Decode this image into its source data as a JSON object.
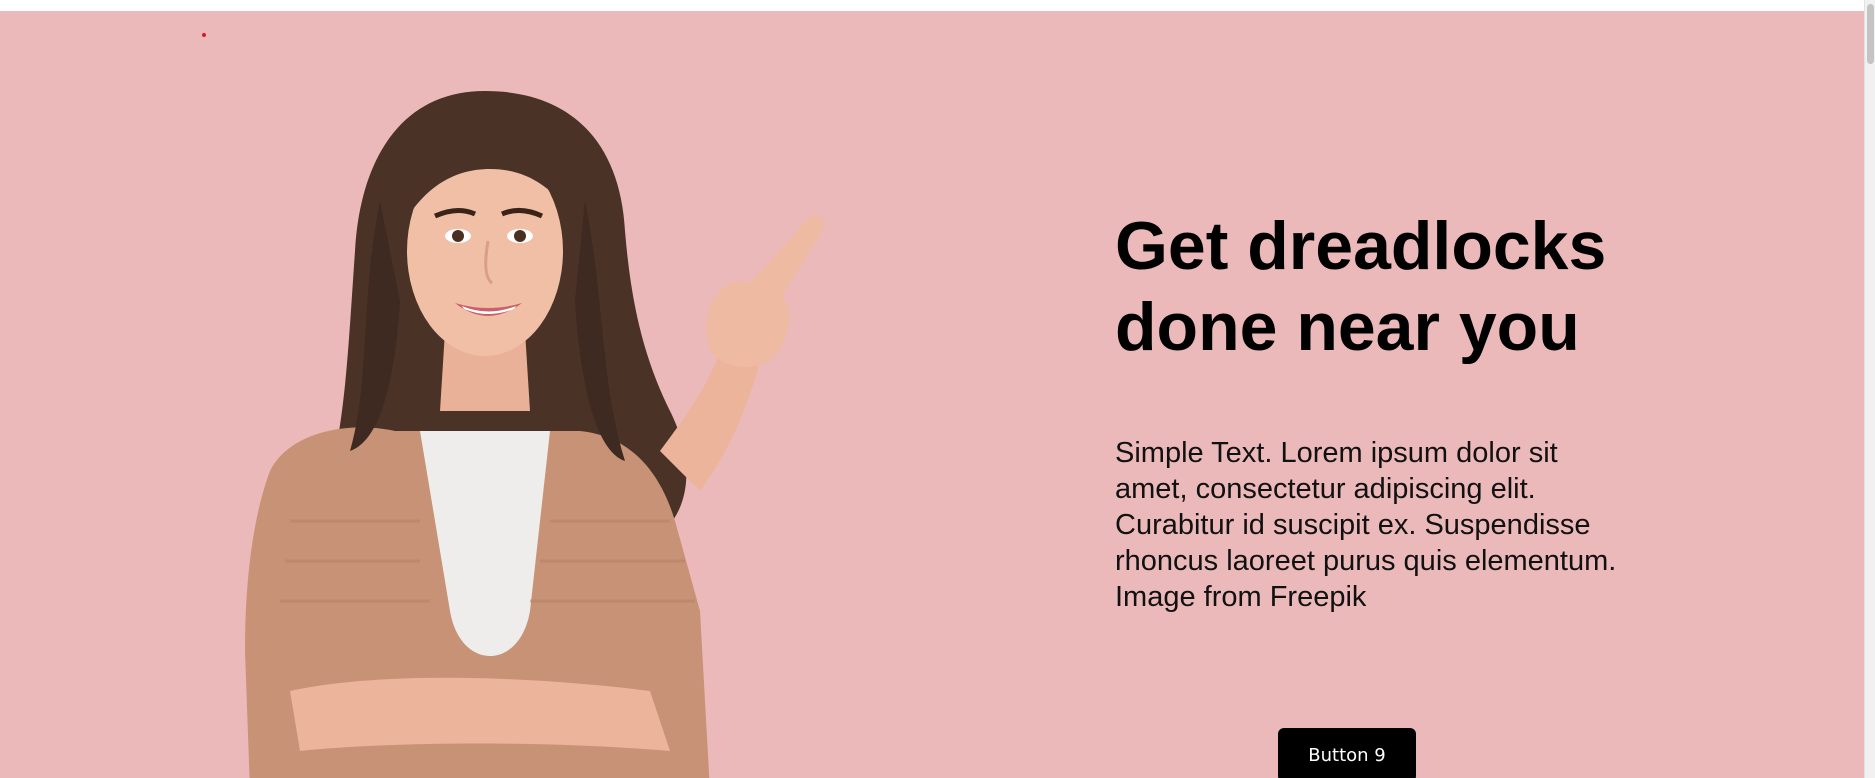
{
  "hero": {
    "headline": "Get dreadlocks done near you",
    "body": "Simple Text. Lorem ipsum dolor sit amet, consectetur adipiscing elit. Curabitur id suscipit ex. Suspendisse rhoncus laoreet purus quis elementum. Image from Freepik",
    "button_label": "Button 9",
    "image_icon": "woman-pointing-photo"
  },
  "colors": {
    "background": "#ecb9bb",
    "button_bg": "#000000",
    "button_text": "#ffffff",
    "marker_dot": "#e0152a"
  }
}
